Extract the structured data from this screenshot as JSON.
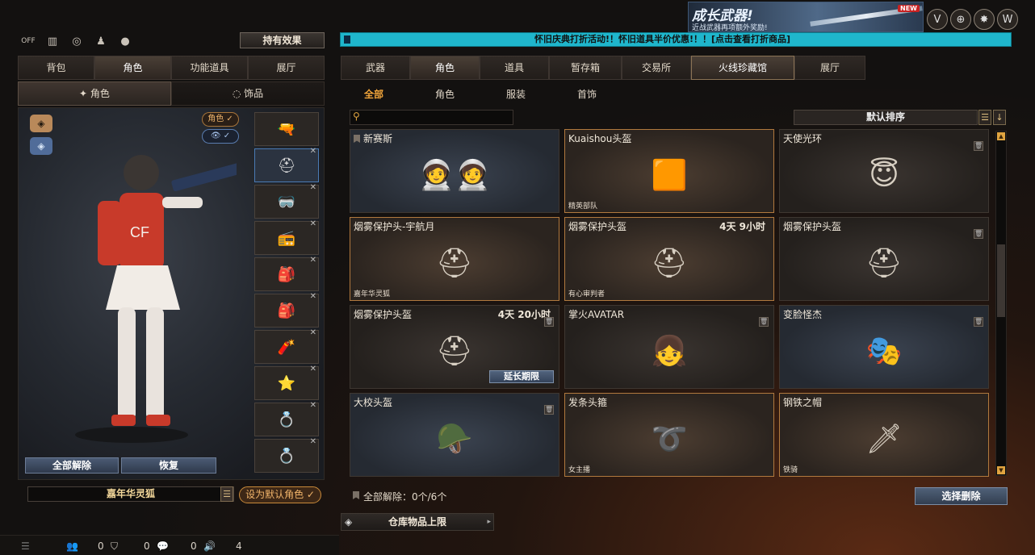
{
  "top_left_icons": [
    "power-off-icon",
    "podium-icon",
    "radar-icon",
    "user-add-icon",
    "grenade-icon"
  ],
  "top_left_off": "OFF",
  "holding_effect": "持有效果",
  "banner": {
    "title": "成长武器!",
    "subtitle": "近战武器再项额外奖励!",
    "badge": "NEW"
  },
  "marquee": "怀旧庆典打折活动!！怀旧道具半价优惠!！！[点击查看打折商品]",
  "left_tabs": [
    "背包",
    "角色",
    "功能道具",
    "展厅"
  ],
  "left_active": "角色",
  "sub_tabs": [
    "角色",
    "饰品"
  ],
  "toggles": {
    "role": "角色 ✓",
    "eye": "👁 ✓"
  },
  "slots": [
    "🔫",
    "⛑",
    "🥽",
    "📻",
    "🎒",
    "🎒",
    "🧨",
    "⭐",
    "💍",
    "💍"
  ],
  "unlock_all": "全部解除",
  "restore": "恢复",
  "char_name": "嘉年华灵狐",
  "set_default": "设为默认角色 ✓",
  "right_tabs": [
    "武器",
    "角色",
    "道具",
    "暂存箱",
    "交易所",
    "火线珍藏馆",
    "展厅"
  ],
  "right_active": "火线珍藏馆",
  "filters": [
    "全部",
    "角色",
    "服装",
    "首饰"
  ],
  "filter_active": "全部",
  "sort": "默认排序",
  "items": [
    {
      "name": "新赛斯",
      "time": "",
      "tag": "",
      "icon": "🧑‍🚀🧑‍🚀",
      "style": "blue",
      "trash": false,
      "bookmark": true
    },
    {
      "name": "Kuaishou头盔",
      "time": "",
      "tag": "精英部队",
      "icon": "🟧",
      "style": "gold",
      "trash": false,
      "bookmark": false
    },
    {
      "name": "天使光环",
      "time": "",
      "tag": "",
      "icon": "😇",
      "style": "plain",
      "trash": true,
      "bookmark": false
    },
    {
      "name": "烟雾保护头-宇航月",
      "time": "",
      "tag": "嘉年华灵狐",
      "icon": "⛑",
      "style": "gold",
      "trash": false,
      "bookmark": false
    },
    {
      "name": "烟雾保护头盔",
      "time": "4天 9小时",
      "tag": "有心审判者",
      "icon": "⛑",
      "style": "gold",
      "trash": false,
      "bookmark": false
    },
    {
      "name": "烟雾保护头盔",
      "time": "",
      "tag": "",
      "icon": "⛑",
      "style": "plain",
      "trash": true,
      "bookmark": false
    },
    {
      "name": "烟雾保护头盔",
      "time": "4天 20小时",
      "tag": "",
      "icon": "⛑",
      "style": "plain",
      "trash": true,
      "bookmark": false,
      "extend": "延长期限"
    },
    {
      "name": "掌火AVATAR",
      "time": "",
      "tag": "",
      "icon": "👧",
      "style": "plain",
      "trash": true,
      "bookmark": false
    },
    {
      "name": "变脸怪杰",
      "time": "",
      "tag": "",
      "icon": "🎭",
      "style": "blue",
      "trash": true,
      "bookmark": false
    },
    {
      "name": "大校头盔",
      "time": "",
      "tag": "",
      "icon": "🪖",
      "style": "blue",
      "trash": true,
      "bookmark": false
    },
    {
      "name": "发条头箍",
      "time": "",
      "tag": "女主播",
      "icon": "➰",
      "style": "gold",
      "trash": false,
      "bookmark": false
    },
    {
      "name": "钢铁之帽",
      "time": "",
      "tag": "铁骑",
      "icon": "🗡",
      "style": "gold",
      "trash": false,
      "bookmark": false
    }
  ],
  "unlock_count": "全部解除：0个/6个",
  "select_delete": "选择删除",
  "storage_limit": "仓库物品上限",
  "bottom": {
    "c1": "0",
    "c2": "0",
    "c3": "0",
    "c4": "4"
  }
}
